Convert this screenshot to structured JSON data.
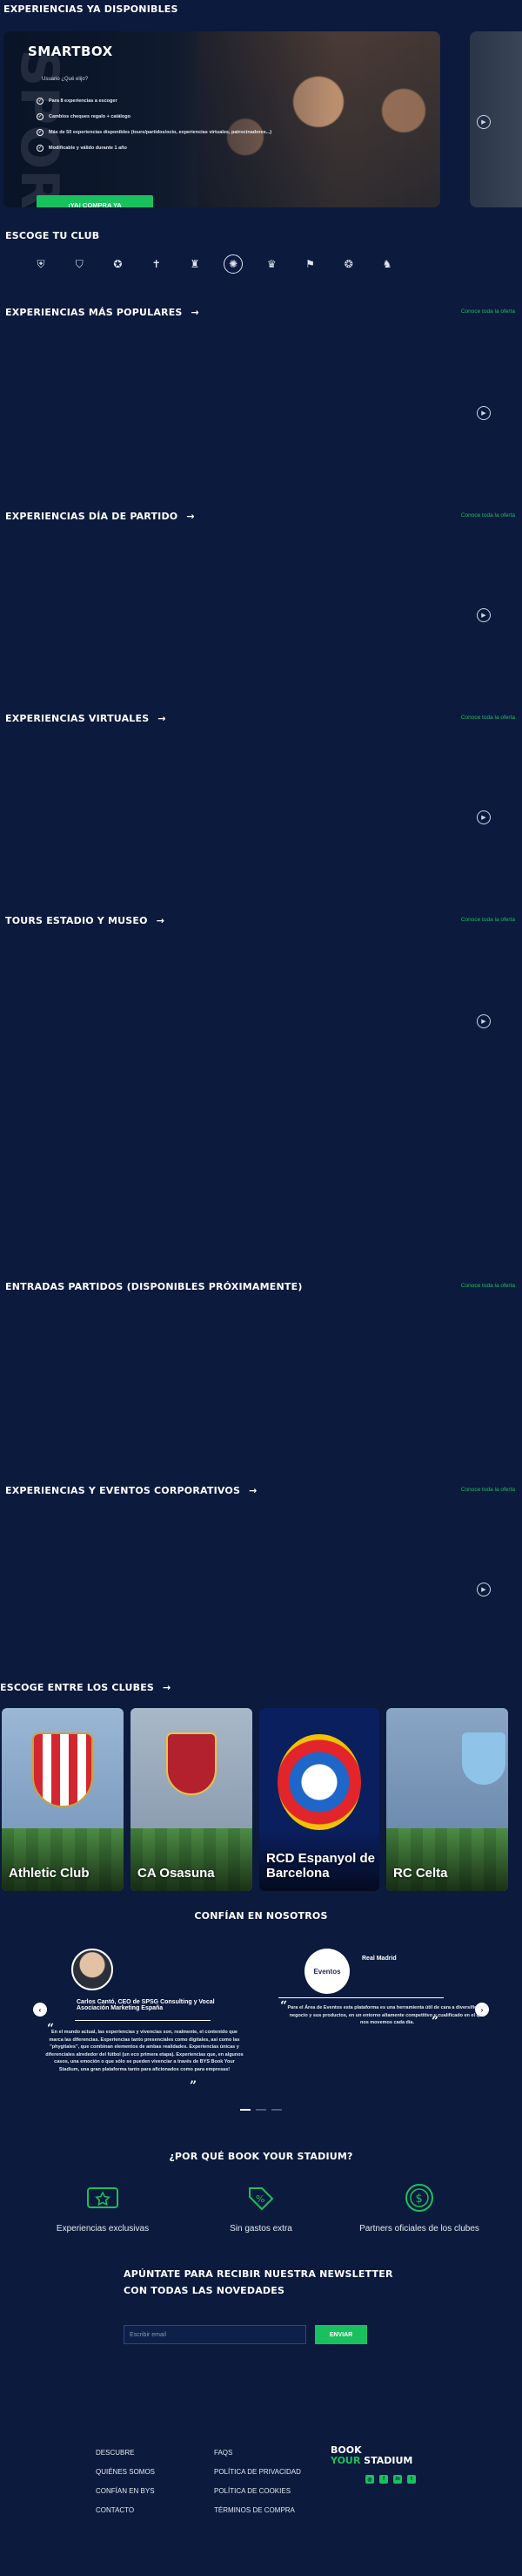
{
  "hero": {
    "title": "EXPERIENCIAS YA DISPONIBLES",
    "brand": "SMARTBOX",
    "subtitle": "Usuario ¿Qué elijo?",
    "features": [
      "Para 8 experiencias a escoger",
      "Cambios cheques regalo + catálogo",
      "Más de 50 experiencias disponibles (tours/partidos/ocio, experiencias virtuales, patrocinadores...)",
      "Modificable y válido durante 1 año"
    ],
    "buy_label": "¡YA! COMPRA YA",
    "bg_letters": "SPORT"
  },
  "clubs": {
    "title": "ESCOGE TU CLUB",
    "logos": [
      "athletic-crest-icon",
      "osasuna-crest-icon",
      "espanyol-crest-icon",
      "cross-crest-icon",
      "betis-crest-icon",
      "sevilla-crest-icon",
      "real-madrid-crest-icon",
      "shield-crest-icon",
      "celta-crest-icon",
      "valencia-crest-icon"
    ]
  },
  "categories": [
    {
      "title": "EXPERIENCIAS MÁS POPULARES",
      "see_all": "Conoce toda la oferta"
    },
    {
      "title": "EXPERIENCIAS DÍA DE PARTIDO",
      "see_all": "Conoce toda la oferta"
    },
    {
      "title": "EXPERIENCIAS VIRTUALES",
      "see_all": "Conoce toda la oferta"
    },
    {
      "title": "TOURS ESTADIO Y MUSEO",
      "see_all": "Conoce toda la oferta"
    },
    {
      "title": "ENTRADAS PARTIDOS (DISPONIBLES PRÓXIMAMENTE)",
      "see_all": "Conoce toda la oferta"
    },
    {
      "title": "EXPERIENCIAS Y EVENTOS CORPORATIVOS",
      "see_all": "Conoce toda la oferta"
    }
  ],
  "club_cards": {
    "title": "ESCOGE ENTRE LOS CLUBES",
    "items": [
      {
        "name": "Athletic Club"
      },
      {
        "name": "CA Osasuna"
      },
      {
        "name": "RCD Espanyol de Barcelona"
      },
      {
        "name": "RC Celta"
      }
    ]
  },
  "trust": {
    "title": "CONFÍAN EN NOSOTROS",
    "testimonials": [
      {
        "name": "Carlos Cantó, CEO de SPSG Consulting y Vocal Asociación Marketing España",
        "quote": "En el mundo actual, las experiencias y vivencias son, realmente, el contenido que marca las diferencias. Experiencias tanto presenciales como digitales, así como las \"phygitales\", que combinan elementos de ambas realidades. Experiencias únicas y diferenciales alrededor del fútbol (un eco primera etapa). Experiencias que, en algunos casos, una emoción o que sólo se pueden vivenciar a través de BYS Book Your Stadium, una gran plataforma tanto para aficionados como para empresas!"
      },
      {
        "name": "Real Madrid",
        "logo_label": "Eventos",
        "quote": "Para el Área de Eventos esta plataforma es una herramienta útil de cara a diversificar el negocio y sus productos, en un entorno altamente competitivo y cualificado en el que nos movemos cada día."
      }
    ]
  },
  "why": {
    "title": "¿POR QUÉ BOOK YOUR STADIUM?",
    "items": [
      {
        "label": "Experiencias exclusivas",
        "icon": "ticket-star-icon"
      },
      {
        "label": "Sin gastos extra",
        "icon": "percent-tag-icon"
      },
      {
        "label": "Partners oficiales de los clubes",
        "icon": "dollar-coin-icon"
      }
    ]
  },
  "newsletter": {
    "title": "APÚNTATE PARA RECIBIR NUESTRA NEWSLETTER CON TODAS LAS NOVEDADES",
    "placeholder": "Escribir email",
    "button": "ENVIAR"
  },
  "footer": {
    "col1": [
      "DESCUBRE",
      "QUIÉNES SOMOS",
      "CONFÍAN EN BYS",
      "CONTACTO"
    ],
    "col2": [
      "FAQS",
      "POLÍTICA DE PRIVACIDAD",
      "POLÍTICA DE COOKIES",
      "TÉRMINOS DE COMPRA"
    ],
    "logo_line1": "BOOK",
    "logo_line2a": "YOUR",
    "logo_line2b": "STADIUM"
  },
  "colors": {
    "background": "#0b1a3d",
    "accent": "#19c15e"
  }
}
